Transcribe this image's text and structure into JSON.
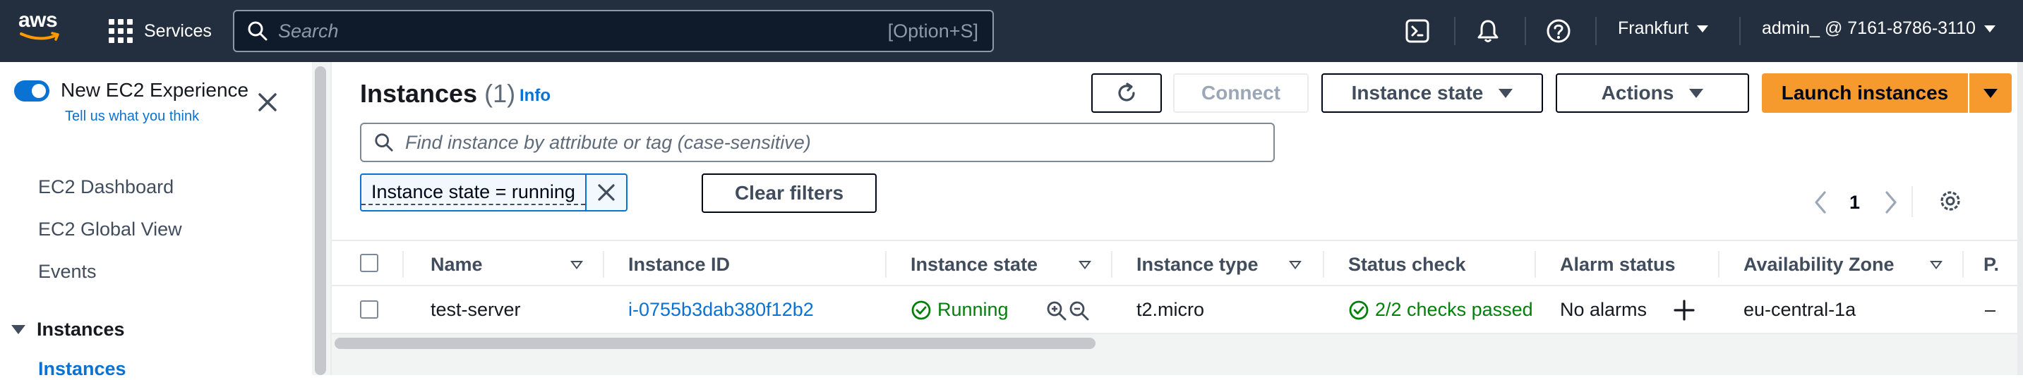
{
  "topnav": {
    "logo_text": "aws",
    "services_label": "Services",
    "search_placeholder": "Search",
    "search_shortcut": "[Option+S]",
    "icons": [
      "cloudshell-icon",
      "bell-icon",
      "help-icon"
    ],
    "region": "Frankfurt",
    "account": "admin_ @ 7161-8786-3110"
  },
  "sidebar": {
    "new_experience_label": "New EC2 Experience",
    "tell_us_link": "Tell us what you think",
    "items": [
      "EC2 Dashboard",
      "EC2 Global View",
      "Events"
    ],
    "section_label": "Instances",
    "sub_item": "Instances"
  },
  "main": {
    "title": "Instances",
    "count": "(1)",
    "info_link": "Info",
    "buttons": {
      "connect": "Connect",
      "instance_state": "Instance state",
      "actions": "Actions",
      "launch": "Launch instances"
    },
    "filter_placeholder": "Find instance by attribute or tag (case-sensitive)",
    "filter_token": "Instance state = running",
    "clear_filters": "Clear filters",
    "page_number": "1"
  },
  "table": {
    "columns": [
      "Name",
      "Instance ID",
      "Instance state",
      "Instance type",
      "Status check",
      "Alarm status",
      "Availability Zone",
      "P."
    ],
    "rows": [
      {
        "name": "test-server",
        "instance_id": "i-0755b3dab380f12b2",
        "state": "Running",
        "type": "t2.micro",
        "status_check": "2/2 checks passed",
        "alarm": "No alarms",
        "az": "eu-central-1a",
        "public": "–"
      }
    ]
  },
  "colors": {
    "nav_bg": "#232f3e",
    "link": "#0972d3",
    "primary": "#f79a2e",
    "success": "#037f0c"
  }
}
